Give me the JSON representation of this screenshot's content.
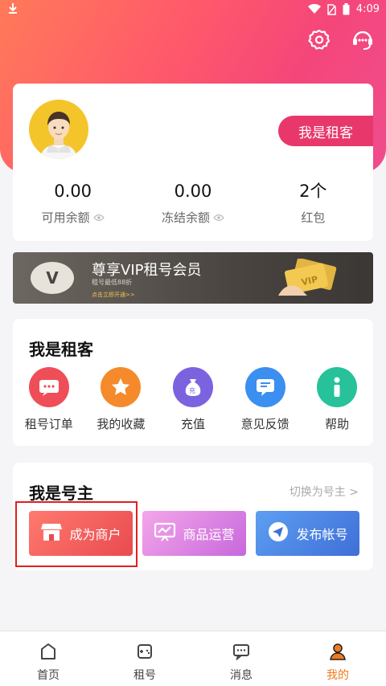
{
  "status_bar": {
    "time": "4:09"
  },
  "top_icons": [
    "gear-icon",
    "customer-service-icon"
  ],
  "profile": {
    "role_tag": "我是租客",
    "stats": [
      {
        "value": "0.00",
        "label": "可用余额",
        "has_eye": true
      },
      {
        "value": "0.00",
        "label": "冻结余额",
        "has_eye": true
      },
      {
        "value": "2个",
        "label": "红包",
        "has_eye": false
      }
    ]
  },
  "vip_banner": {
    "logo_letter": "V",
    "title": "尊享VIP租号会员",
    "subtitle": "租号最低88折",
    "cta": "点击立即开通>>",
    "card_text": "VIP"
  },
  "tenant_section": {
    "title": "我是租客",
    "items": [
      {
        "label": "租号订单",
        "icon": "order-icon",
        "color": "#ef4e58"
      },
      {
        "label": "我的收藏",
        "icon": "star-icon",
        "color": "#f58a2c"
      },
      {
        "label": "充值",
        "icon": "money-bag-icon",
        "color": "#7b63e0",
        "badge": "充"
      },
      {
        "label": "意见反馈",
        "icon": "feedback-icon",
        "color": "#3a8ff0"
      },
      {
        "label": "帮助",
        "icon": "info-icon",
        "color": "#27c29a"
      }
    ]
  },
  "owner_section": {
    "title": "我是号主",
    "switch_link": "切换为号主 >",
    "buttons": [
      {
        "label": "成为商户",
        "icon": "shop-icon"
      },
      {
        "label": "商品运营",
        "icon": "chart-board-icon"
      },
      {
        "label": "发布帐号",
        "icon": "paper-plane-icon"
      }
    ]
  },
  "tabbar": {
    "tabs": [
      {
        "label": "首页",
        "icon": "home-icon"
      },
      {
        "label": "租号",
        "icon": "gamepad-icon"
      },
      {
        "label": "消息",
        "icon": "message-icon"
      },
      {
        "label": "我的",
        "icon": "user-icon",
        "active": true
      }
    ]
  },
  "colors": {
    "accent": "#e8386b",
    "tab_active": "#f07a1e",
    "highlight_border": "#e02020"
  }
}
